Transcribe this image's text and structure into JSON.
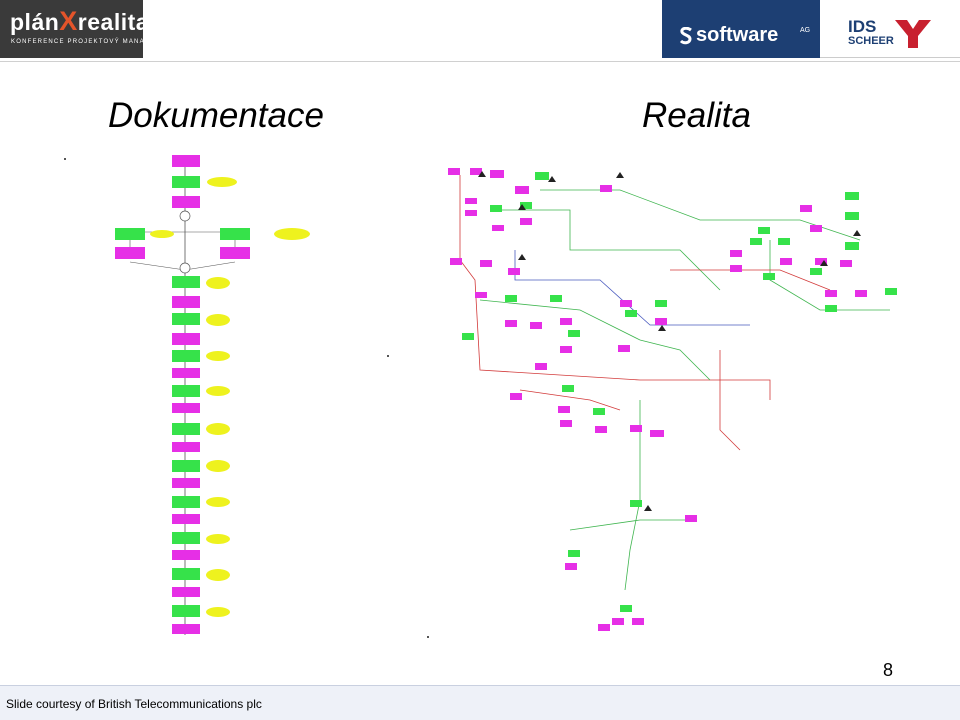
{
  "header": {
    "plan_logo": "plán",
    "plan_x": "X",
    "plan_logo2": "realita",
    "plan_sub": "KONFERENCE PROJEKTOVÝ MANAGEMENT",
    "software_logo": "software",
    "software_ag": "AG",
    "ids_logo": "IDS",
    "ids_sub": "SCHEER"
  },
  "slide": {
    "title_left": "Dokumentace",
    "title_right": "Realita",
    "page_number": "8",
    "footer": "Slide courtesy of British Telecommunications plc"
  },
  "colors": {
    "event": "#e62fe6",
    "function": "#36e24a",
    "system": "#eef21e",
    "flow_red": "#d23a3a",
    "flow_green": "#3fb54f",
    "flow_blue": "#4a5bbf",
    "software_bg": "#1d3f73"
  }
}
